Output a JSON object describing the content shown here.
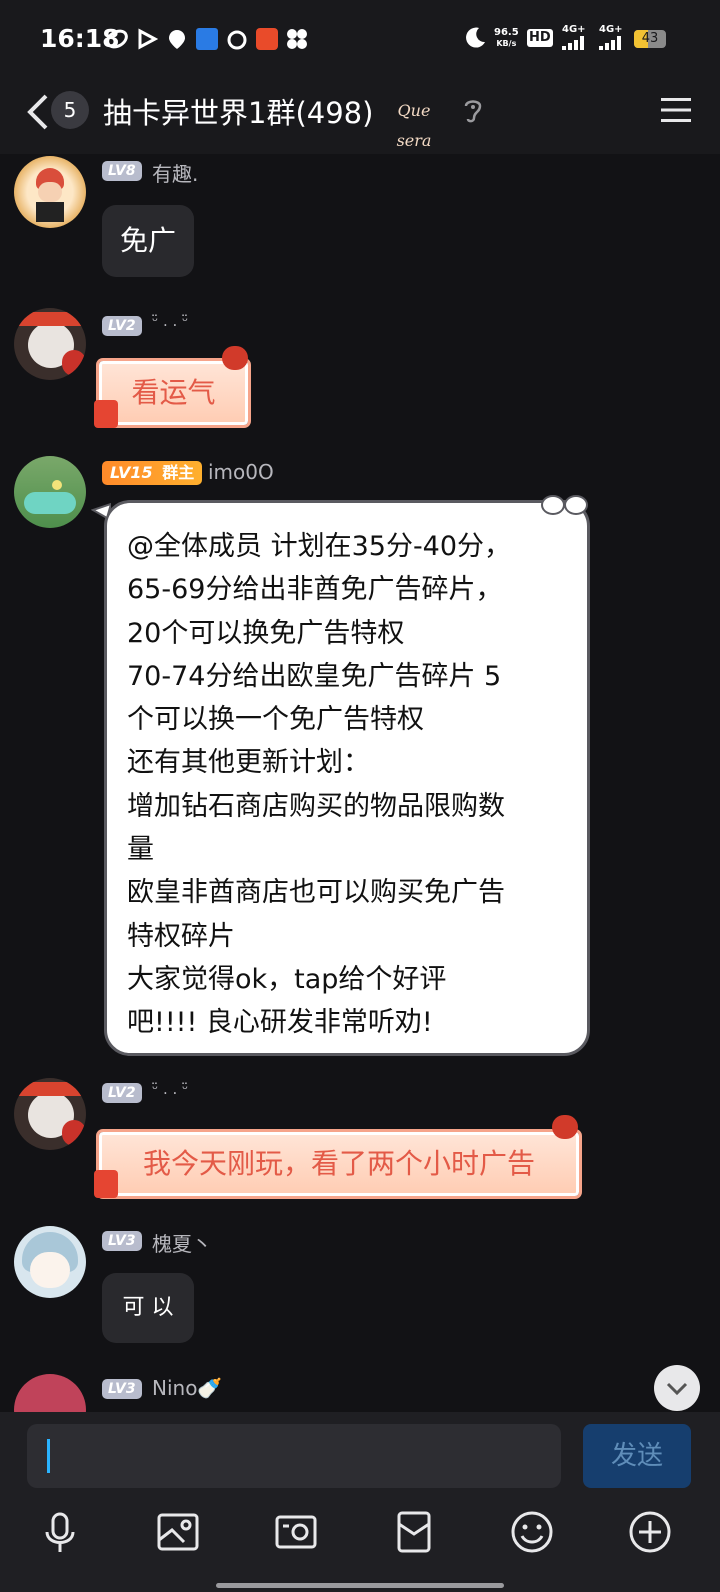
{
  "status_bar": {
    "time": "16:18",
    "speed_value": "96.5",
    "speed_unit": "KB/s",
    "hd_label": "HD",
    "net1": "4G+",
    "net2": "4G+",
    "battery": "43"
  },
  "header": {
    "unread_count": "5",
    "title": "抽卡异世界1群(498)",
    "badge_text": "Que sera"
  },
  "messages": [
    {
      "level": "LV8",
      "name": "有趣.",
      "text": "免广"
    },
    {
      "level": "LV2",
      "name": "ᵕ̈ . . ᵕ̈",
      "text": "看运气"
    },
    {
      "level": "LV15",
      "role": "群主",
      "name": "imo0O",
      "text": "@全体成员 计划在35分-40分，\n65-69分给出非酋免广告碎片，\n20个可以换免广告特权\n70-74分给出欧皇免广告碎片  5\n个可以换一个免广告特权\n还有其他更新计划：\n增加钻石商店购买的物品限购数\n量\n欧皇非酋商店也可以购买免广告\n特权碎片\n大家觉得ok，tap给个好评\n吧!!!!  良心研发非常听劝!"
    },
    {
      "level": "LV2",
      "name": "ᵕ̈ . . ᵕ̈",
      "text": "我今天刚玩，看了两个小时广告"
    },
    {
      "level": "LV3",
      "name": "槐夏丶",
      "text": "可 以"
    },
    {
      "level": "LV3",
      "name": "Nino🍼",
      "text": ""
    }
  ],
  "input": {
    "placeholder": "",
    "send_label": "发送"
  },
  "toolbar": [
    "microphone-icon",
    "image-icon",
    "camera-icon",
    "red-packet-icon",
    "emoji-icon",
    "plus-icon"
  ]
}
